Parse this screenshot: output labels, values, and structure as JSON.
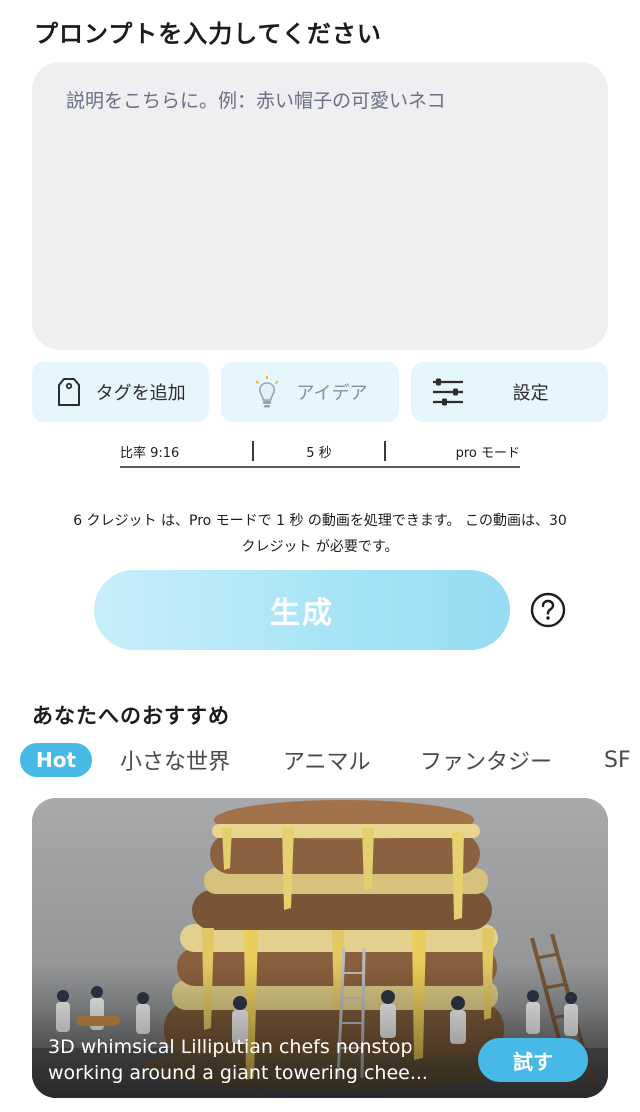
{
  "page_title": "プロンプトを入力してください",
  "prompt": {
    "placeholder": "説明をこちらに。例：赤い帽子の可愛いネコ",
    "value": ""
  },
  "actions": {
    "add_tag": {
      "label": "タグを追加",
      "icon": "tag-icon"
    },
    "idea": {
      "label": "アイデア",
      "icon": "lightbulb-icon"
    },
    "settings": {
      "label": "設定",
      "icon": "sliders-icon"
    }
  },
  "options": {
    "ratio": "比率 9:16",
    "duration": "5 秒",
    "mode": "pro モード"
  },
  "credit_info": {
    "line1": "6 クレジット は、Pro モードで 1 秒 の動画を処理できます。 この動画は、30",
    "line2": "クレジット が必要です。"
  },
  "generate_label": "生成",
  "help_icon": "question-circle-icon",
  "recommend_title": "あなたへのおすすめ",
  "tabs": [
    "Hot",
    "小さな世界",
    "アニマル",
    "ファンタジー",
    "SF"
  ],
  "active_tab": "Hot",
  "card": {
    "caption_line1": "3D whimsical Lilliputian chefs nonstop",
    "caption_line2": "working around a giant towering chee...",
    "try_label": "試す"
  },
  "colors": {
    "accent": "#47b9e6",
    "action_bg": "#e5f6fd",
    "prompt_bg": "#efeff1"
  }
}
